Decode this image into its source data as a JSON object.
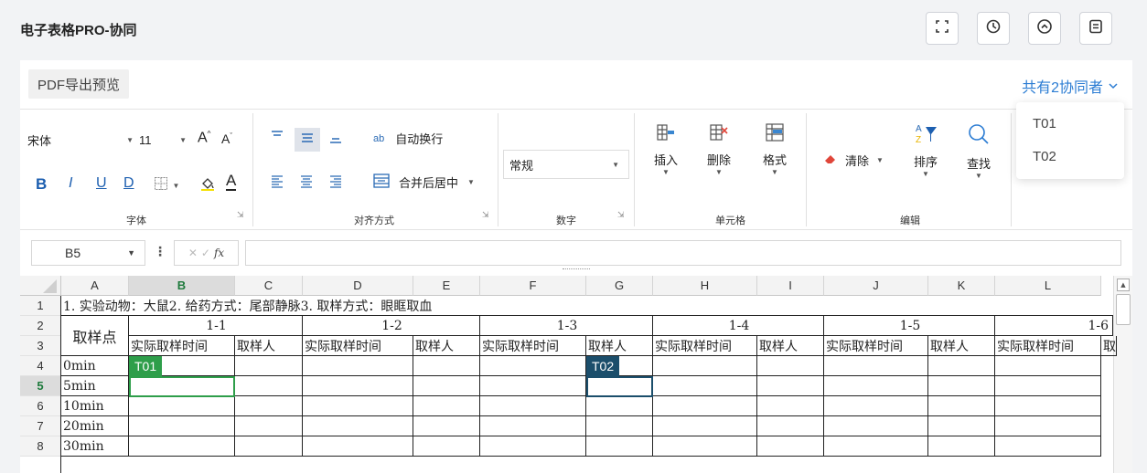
{
  "page": {
    "title": "电子表格PRO-协同"
  },
  "header_buttons": [
    {
      "name": "fullscreen-icon"
    },
    {
      "name": "history-icon"
    },
    {
      "name": "collapse-up-icon"
    },
    {
      "name": "comment-icon"
    }
  ],
  "toolbar": {
    "pdf_export_label": "PDF导出预览",
    "collaborators_label": "共有2协同者",
    "collaborators": [
      "T01",
      "T02"
    ]
  },
  "ribbon": {
    "font": {
      "group_label": "字体",
      "font_name": "宋体",
      "font_size": "11",
      "bold": "B",
      "italic": "I",
      "underline": "U",
      "double_underline": "D",
      "grow": "A",
      "shrink": "A",
      "font_color": "A"
    },
    "align": {
      "group_label": "对齐方式",
      "wrap_label": "自动换行",
      "merge_label": "合并后居中",
      "wrap_icon_text": "ab"
    },
    "number": {
      "group_label": "数字",
      "format": "常规"
    },
    "cells": {
      "group_label": "单元格",
      "insert": "插入",
      "delete": "删除",
      "format": "格式"
    },
    "edit": {
      "group_label": "编辑",
      "clear": "清除",
      "sort": "排序",
      "find": "查找"
    }
  },
  "formula_bar": {
    "cell_ref": "B5",
    "fx": "fx",
    "value": ""
  },
  "grid": {
    "columns": [
      "A",
      "B",
      "C",
      "D",
      "E",
      "F",
      "G",
      "H",
      "I",
      "J",
      "K",
      "L"
    ],
    "active_column": "B",
    "row_numbers": [
      "1",
      "2",
      "3",
      "4",
      "5",
      "6",
      "7",
      "8"
    ],
    "active_row": "5",
    "row1_text": "1. 实验动物：大鼠2. 给药方式：尾部静脉3. 取样方式：眼眶取血",
    "sample_point_label": "取样点",
    "groups": [
      "1-1",
      "1-2",
      "1-3",
      "1-4",
      "1-5",
      "1-6"
    ],
    "actual_time_label": "实际取样时间",
    "sampler_label": "取样人",
    "sampler_label_truncated": "取",
    "times": [
      "0min",
      "5min",
      "10min",
      "20min",
      "30min"
    ],
    "cursors": [
      {
        "label": "T01",
        "color": "#2e9e4a"
      },
      {
        "label": "T02",
        "color": "#1b4e6b"
      }
    ]
  }
}
